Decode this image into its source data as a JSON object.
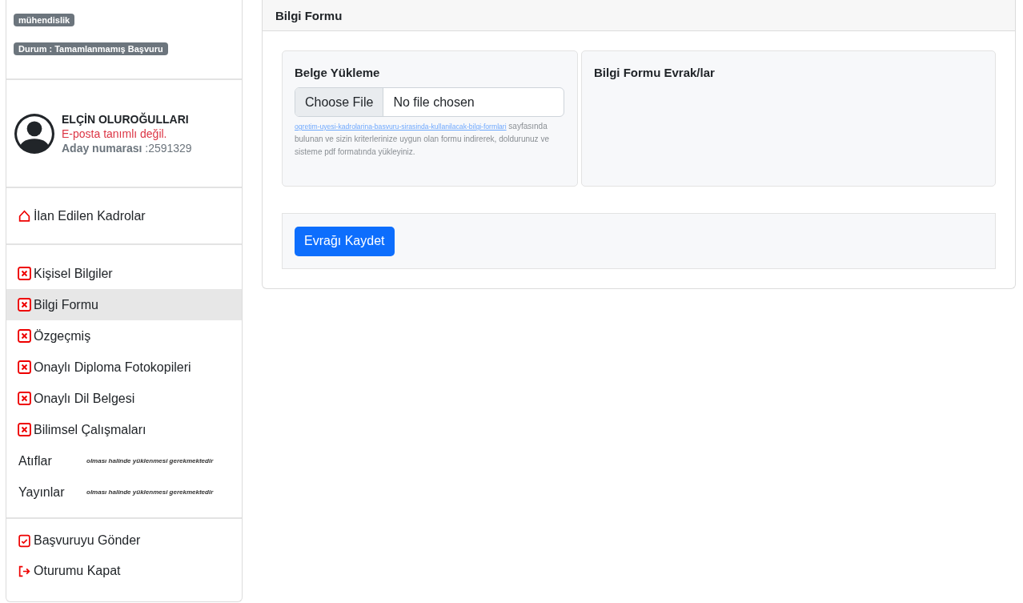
{
  "sidebar": {
    "badges": [
      "mühendislik",
      "Durum : Tamamlanmamış Başvuru"
    ],
    "profile": {
      "name": "ELÇİN OLUROĞULLARI",
      "email_status": "E-posta tanımlı değil.",
      "candidate": "**Aday numarası** :2591329"
    },
    "home_link": "İlan Edilen Kadrolar",
    "menu": [
      {
        "label": "Kişisel Bilgiler",
        "kind": "incomplete",
        "selected": false
      },
      {
        "label": "Bilgi Formu",
        "kind": "incomplete",
        "selected": true
      },
      {
        "label": "Özgeçmiş",
        "kind": "incomplete",
        "selected": false
      },
      {
        "label": "Onaylı Diploma Fotokopileri",
        "kind": "incomplete",
        "selected": false
      },
      {
        "label": "Onaylı Dil Belgesi",
        "kind": "incomplete",
        "selected": false
      },
      {
        "label": "Bilimsel Çalışmaları",
        "kind": "incomplete",
        "selected": false
      },
      {
        "label": "Atıflar",
        "kind": "optional",
        "note": "olması halinde yüklenmesi gerekmektedir",
        "selected": false
      },
      {
        "label": "Yayınlar",
        "kind": "optional",
        "note": "olması halinde yüklenmesi gerekmektedir",
        "selected": false
      }
    ],
    "actions": [
      {
        "label": "Başvuruyu Gönder",
        "kind": "submit"
      },
      {
        "label": "Oturumu Kapat",
        "kind": "logout"
      }
    ]
  },
  "panel": {
    "title": "Bilgi Formu",
    "upload": {
      "title": "Belge Yükleme",
      "button": "Choose File",
      "file_status": "No file chosen",
      "help_link": "ogretim-uyesi-kadrolarina-basvuru-sirasinda-kullanilacak-bilgi-formlari",
      "help_text": "sayfasında bulunan ve sizin kriterlerinize uygun olan formu indirerek, doldurunuz ve sisteme pdf formatında yükleyiniz."
    },
    "documents": {
      "title": "Bilgi Formu Evrak/lar"
    },
    "save_button": "Evrağı Kaydet"
  }
}
